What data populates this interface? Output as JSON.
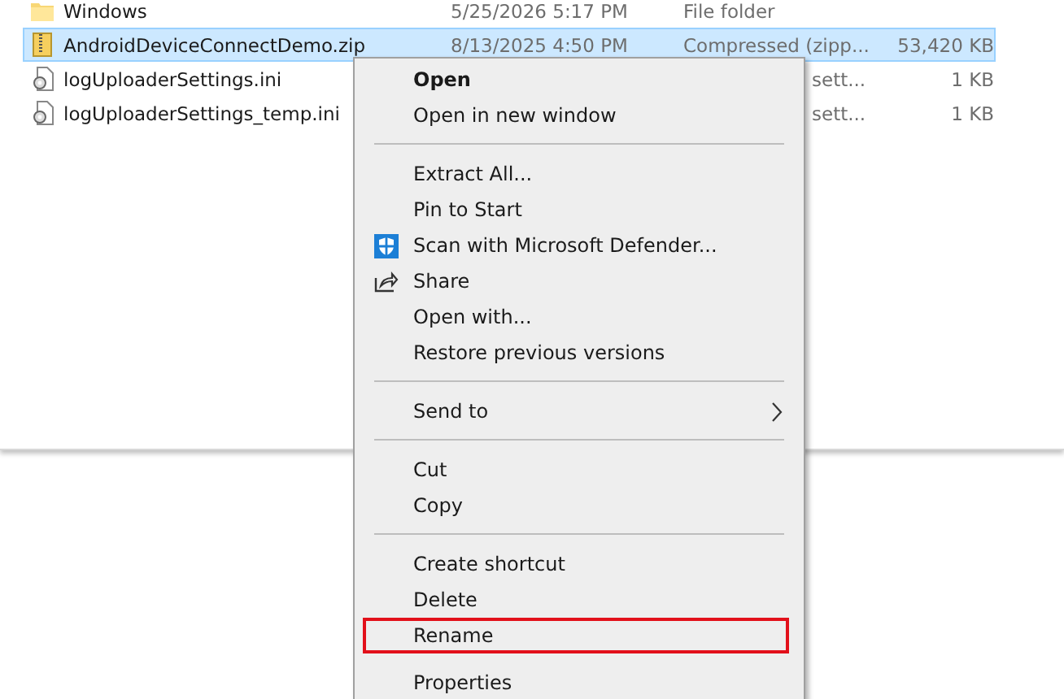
{
  "files": [
    {
      "kind": "folder",
      "name": "Windows",
      "date": "5/25/2026 5:17 PM",
      "type": "File folder",
      "selected": false
    },
    {
      "kind": "zip",
      "name": "AndroidDeviceConnectDemo.zip",
      "date": "8/13/2025 4:50 PM",
      "type": "Compressed (zipp...",
      "size": "53,420 KB",
      "selected": true
    },
    {
      "kind": "settings",
      "name": "logUploaderSettings.ini",
      "type": "sett...",
      "size": "1 KB",
      "selected": false
    },
    {
      "kind": "settings",
      "name": "logUploaderSettings_temp.ini",
      "type": "sett...",
      "size": "1 KB",
      "selected": false
    }
  ],
  "context_menu": {
    "items": [
      {
        "kind": "item",
        "label": "Open",
        "bold": true
      },
      {
        "kind": "item",
        "label": "Open in new window"
      },
      {
        "kind": "separator"
      },
      {
        "kind": "item",
        "label": "Extract All..."
      },
      {
        "kind": "item",
        "label": "Pin to Start"
      },
      {
        "kind": "defender",
        "label": "Scan with Microsoft Defender..."
      },
      {
        "kind": "share",
        "label": "Share"
      },
      {
        "kind": "item",
        "label": "Open with..."
      },
      {
        "kind": "item",
        "label": "Restore previous versions"
      },
      {
        "kind": "separator"
      },
      {
        "kind": "submenu",
        "label": "Send to"
      },
      {
        "kind": "separator"
      },
      {
        "kind": "item",
        "label": "Cut"
      },
      {
        "kind": "item",
        "label": "Copy"
      },
      {
        "kind": "separator"
      },
      {
        "kind": "item",
        "label": "Create shortcut"
      },
      {
        "kind": "item",
        "label": "Delete"
      },
      {
        "kind": "item",
        "label": "Rename",
        "highlighted": true
      },
      {
        "kind": "gap"
      },
      {
        "kind": "item",
        "label": "Properties"
      }
    ]
  }
}
